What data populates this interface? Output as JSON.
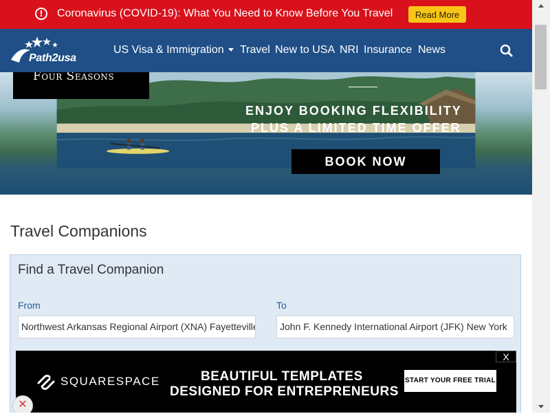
{
  "alert": {
    "icon": "info-circle-icon",
    "text": "Coronavirus (COVID-19): What You Need to Know Before You Travel",
    "button_label": "Read More",
    "bg_color": "#d9111c",
    "button_color": "#f6c516"
  },
  "nav": {
    "logo_text": "Path2usa",
    "items": [
      {
        "label": "US Visa & Immigration",
        "has_dropdown": true
      },
      {
        "label": "Travel"
      },
      {
        "label": "New to USA"
      },
      {
        "label": "NRI"
      },
      {
        "label": "Insurance"
      },
      {
        "label": "News"
      }
    ],
    "search_icon": "search-icon",
    "bg_color": "#1f4f86"
  },
  "hero_ad": {
    "brand": "Four Seasons",
    "headline_1": "ENJOY BOOKING FLEXIBILITY",
    "headline_2": "PLUS A LIMITED TIME OFFER",
    "cta": "BOOK NOW"
  },
  "main": {
    "title": "Travel Companions",
    "panel": {
      "title": "Find a Travel Companion",
      "from_label": "From",
      "from_value": "Northwest Arkansas Regional Airport (XNA) Fayetteville",
      "to_label": "To",
      "to_value": "John F. Kennedy International Airport (JFK) New York"
    }
  },
  "bottom_ad": {
    "brand": "SQUARESPACE",
    "headline_1": "BEAUTIFUL TEMPLATES",
    "headline_2": "DESIGNED FOR ENTREPRENEURS",
    "cta": "START YOUR FREE TRIAL",
    "close_label": "X"
  }
}
